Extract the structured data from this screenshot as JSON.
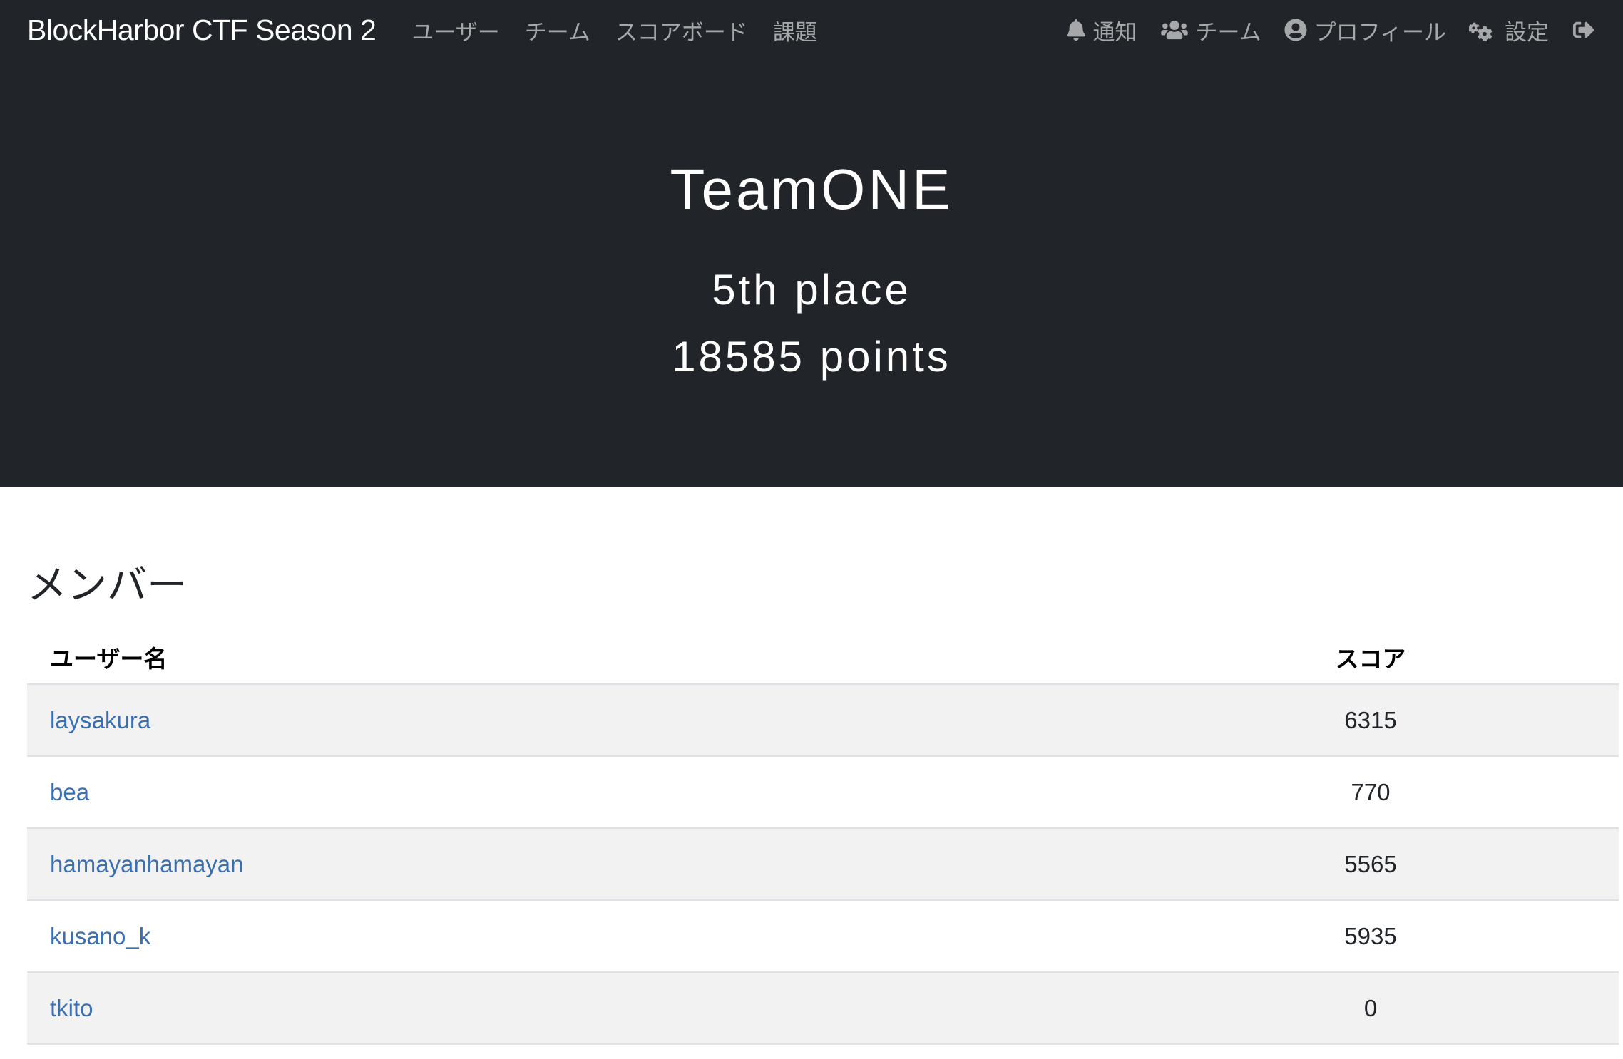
{
  "navbar": {
    "brand": "BlockHarbor CTF Season 2",
    "left_links": [
      {
        "label": "ユーザー"
      },
      {
        "label": "チーム"
      },
      {
        "label": "スコアボード"
      },
      {
        "label": "課題"
      }
    ],
    "right_items": [
      {
        "label": "通知",
        "icon": "bell-icon"
      },
      {
        "label": "チーム",
        "icon": "users-icon"
      },
      {
        "label": "プロフィール",
        "icon": "user-circle-icon"
      },
      {
        "label": "設定",
        "icon": "cogs-icon"
      },
      {
        "label": "",
        "icon": "sign-out-icon"
      }
    ]
  },
  "team": {
    "name": "TeamONE",
    "place": "5th place",
    "points": "18585 points"
  },
  "members": {
    "heading": "メンバー",
    "columns": {
      "username": "ユーザー名",
      "score": "スコア"
    },
    "rows": [
      {
        "username": "laysakura",
        "score": "6315"
      },
      {
        "username": "bea",
        "score": "770"
      },
      {
        "username": "hamayanhamayan",
        "score": "5565"
      },
      {
        "username": "kusano_k",
        "score": "5935"
      },
      {
        "username": "tkito",
        "score": "0"
      }
    ]
  },
  "colors": {
    "navbar_bg": "#212529",
    "link": "#3b6fb0",
    "row_stripe": "#f2f2f2"
  }
}
